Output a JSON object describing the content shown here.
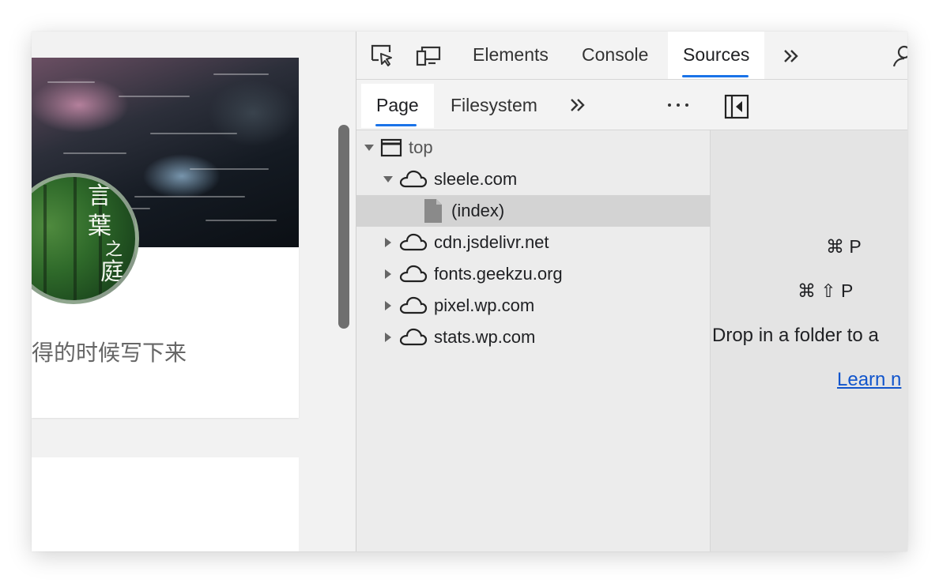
{
  "webpage": {
    "cover_glyphs": [
      "言",
      "葉",
      "之",
      "庭"
    ],
    "excerpt": "得的时候写下来"
  },
  "devtools": {
    "top_tabs": [
      {
        "label": "Elements",
        "active": false
      },
      {
        "label": "Console",
        "active": false
      },
      {
        "label": "Sources",
        "active": true
      }
    ],
    "nav_tabs": [
      {
        "label": "Page",
        "active": true
      },
      {
        "label": "Filesystem",
        "active": false
      }
    ],
    "tree": {
      "root": "top",
      "origins": [
        {
          "label": "sleele.com",
          "expanded": true,
          "children": [
            {
              "label": "(index)",
              "selected": true
            }
          ]
        },
        {
          "label": "cdn.jsdelivr.net",
          "expanded": false
        },
        {
          "label": "fonts.geekzu.org",
          "expanded": false
        },
        {
          "label": "pixel.wp.com",
          "expanded": false
        },
        {
          "label": "stats.wp.com",
          "expanded": false
        }
      ]
    },
    "editor": {
      "shortcut_open_file": "⌘ P",
      "shortcut_run_command": "⌘ ⇧ P",
      "drop_hint": "Drop in a folder to a",
      "learn_more": "Learn n"
    },
    "colors": {
      "accent": "#1a73e8",
      "link": "#1155cc",
      "selected_row": "#d3d3d3"
    }
  }
}
